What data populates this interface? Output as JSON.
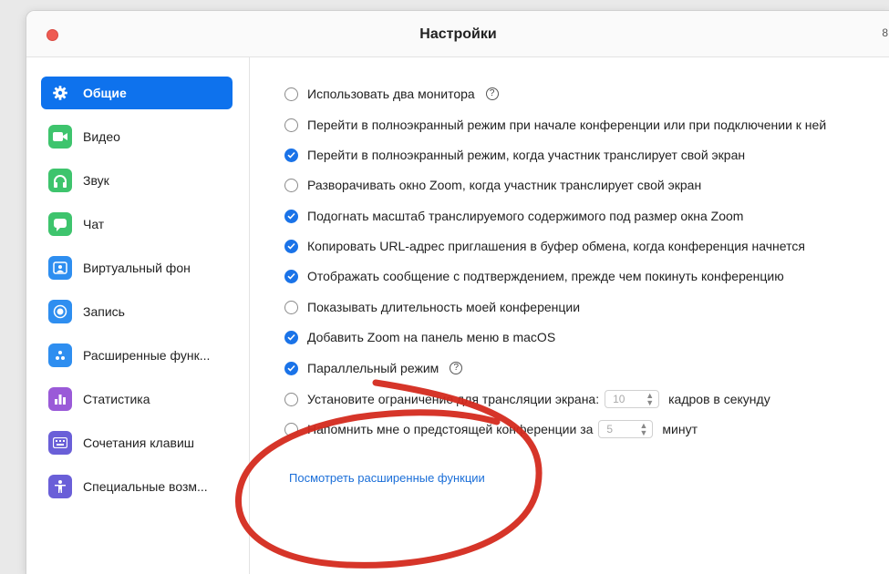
{
  "window": {
    "title": "Настройки",
    "edge_char": "8"
  },
  "colors": {
    "accent": "#0e72ed",
    "check": "#1a73e8",
    "link": "#1a6ed8",
    "annotation": "#d42a1e"
  },
  "sidebar": {
    "items": [
      {
        "label": "Общие",
        "icon": "gear-icon",
        "active": true
      },
      {
        "label": "Видео",
        "icon": "video-camera-icon",
        "active": false
      },
      {
        "label": "Звук",
        "icon": "headphones-icon",
        "active": false
      },
      {
        "label": "Чат",
        "icon": "chat-bubble-icon",
        "active": false
      },
      {
        "label": "Виртуальный фон",
        "icon": "virtual-background-icon",
        "active": false
      },
      {
        "label": "Запись",
        "icon": "record-icon",
        "active": false
      },
      {
        "label": "Расширенные функ...",
        "icon": "advanced-features-icon",
        "active": false
      },
      {
        "label": "Статистика",
        "icon": "bar-chart-icon",
        "active": false
      },
      {
        "label": "Сочетания клавиш",
        "icon": "keyboard-icon",
        "active": false
      },
      {
        "label": "Специальные возм...",
        "icon": "accessibility-icon",
        "active": false
      }
    ]
  },
  "settings": {
    "options": [
      {
        "label": "Использовать два монитора",
        "checked": false
      },
      {
        "label": "Перейти в полноэкранный режим при начале конференции или при подключении к ней",
        "checked": false
      },
      {
        "label": "Перейти в полноэкранный режим, когда участник транслирует свой экран",
        "checked": true
      },
      {
        "label": "Разворачивать окно Zoom, когда участник транслирует свой экран",
        "checked": false
      },
      {
        "label": "Подогнать масштаб транслируемого содержимого под размер окна Zoom",
        "checked": true
      },
      {
        "label": "Копировать URL-адрес приглашения в буфер обмена, когда конференция начнется",
        "checked": true
      },
      {
        "label": "Отображать сообщение с подтверждением, прежде чем покинуть конференцию",
        "checked": true
      },
      {
        "label": "Показывать длительность моей конференции",
        "checked": false
      },
      {
        "label": "Добавить Zoom на панель меню в macOS",
        "checked": true
      },
      {
        "label": "Параллельный режим",
        "checked": true
      }
    ],
    "fps_limit": {
      "label": "Установите ограничение для трансляции экрана:",
      "value": "10",
      "suffix": "кадров в секунду",
      "checked": false
    },
    "reminder": {
      "label": "Напомнить мне о предстоящей конференции за",
      "value": "5",
      "suffix": "минут",
      "checked": false
    },
    "help_glyph": "?",
    "advanced_link": "Посмотреть расширенные функции"
  }
}
